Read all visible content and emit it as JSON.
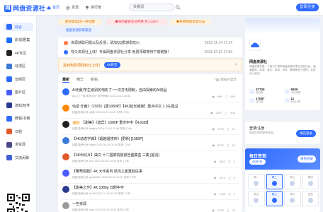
{
  "brand": {
    "name": "网盘资源社"
  },
  "nav": {
    "home": "首页",
    "discover": "发现",
    "rank": "排行榜"
  },
  "search": {
    "value": "关键词"
  },
  "header": {
    "login": "登录/注册"
  },
  "sidebar": {
    "items": [
      {
        "label": "综合",
        "icon": "grid-icon",
        "color": "#2f6bff"
      },
      {
        "label": "影视/剧集",
        "icon": "film-icon",
        "color": "#1f6fff"
      },
      {
        "label": "4K专区",
        "icon": "4k-icon",
        "color": "#222222"
      },
      {
        "label": "动漫区",
        "icon": "anime-icon",
        "color": "#3a7bd5"
      },
      {
        "label": "音频区",
        "icon": "music-icon",
        "color": "#2f6bff"
      },
      {
        "label": "图片区",
        "icon": "image-icon",
        "color": "#4b5cff"
      },
      {
        "label": "游戏/软件",
        "icon": "game-icon",
        "color": "#2a3b8f"
      },
      {
        "label": "教程/书籍",
        "icon": "book-icon",
        "color": "#2f6bff"
      },
      {
        "label": "日剧",
        "icon": "calendar-icon",
        "color": "#e05a2b"
      },
      {
        "label": "求资源",
        "icon": "help-icon",
        "color": "#4a4a8a"
      },
      {
        "label": "交流闲聊",
        "icon": "chat-icon",
        "color": "#3f61d4"
      }
    ]
  },
  "chips": [
    {
      "label": "愿世間美好(一帶觉醒",
      "bg": "#fff3e0",
      "fg": "#e07400"
    },
    {
      "label": "◆海豹暑假会员特惠·月入500+",
      "bg": "#ffe6e6",
      "fg": "#e0455b"
    },
    {
      "label": "◆免费网盘资源论坛",
      "bg": "#fff3e0",
      "fg": "#e07400"
    },
    {
      "label": "速度资源获取渠道",
      "bg": "#e9f0ff",
      "fg": "#2f6bff"
    }
  ],
  "notices": [
    {
      "text": "资源获取问题以及反馈，请加QQ群获取加入",
      "date": "2022-11-14 17:14"
    },
    {
      "text": "夸父资源社上线！专属网盘资源社分享 免费领取等待下载链接！",
      "date": "2023-12-22 17:59"
    }
  ],
  "signin_banner": {
    "text": "签到免费领取积分上线！",
    "pill": "4K彩宝",
    "close": "×"
  },
  "tabs": {
    "latest": "最新",
    "hot": "精华",
    "new": "新帖"
  },
  "toggle": {
    "label": "新帖只显示"
  },
  "posts": [
    {
      "title": "AI无敌!学生级别的电影了~一次打无限制，自由探索的AI商品",
      "meta": "AI入门一族  美术设计  和平教育 2022-12-12 23:58",
      "views": "999",
      "comments": "999",
      "tag": "",
      "avatar": "#2f6bff"
    },
    {
      "title": "仙逆 年番2（2025）[更1080P】【4K/蓝光链接】重点中文 1.3G/集总",
      "meta": "网盘资源分享  动漫  2022-08-13 16:47  发布了8天",
      "views": "2297",
      "comments": "400",
      "tag": "",
      "avatar": "#ff8a00"
    },
    {
      "title": "【甜美】《诡异》1080P 重庆中字【4.6GB】",
      "meta": "网盘资源分享  fanguy  2024-01-15 21:48  发帖了4天",
      "views": "7278",
      "comments": "10",
      "tag": "最新",
      "avatar": "#222222"
    },
    {
      "title": "【4K动态字典】《超越遁境传》[更新] [1080P]",
      "meta": "网盘资源分享  biiant  2022-09-24 02:00  发布了9天",
      "views": "3122",
      "comments": "62",
      "tag": "",
      "avatar": "#3a7bd5"
    },
    {
      "title": "【4K科幻片】曲文 十二国赋情报报告图集盒 三集 [超清]",
      "meta": "网盘资源分享  foxy  2022-09-18 13:00  发布了1年",
      "views": "2522",
      "comments": "3",
      "tag": "",
      "avatar": "#e05a2b"
    },
    {
      "title": "【葡萄短剧】4K 大作系列 凤鸣之夏重回往事",
      "meta": "网盘资源分享  gus0628a  2022-09-13 12:00  发布了2年",
      "views": "2179",
      "comments": "0",
      "tag": "",
      "avatar": "#4b5cff"
    },
    {
      "title": "【甜美之作】4K 1080p 日剧中字",
      "meta": "网盘资源分享  fox03  2021-11-09 15:35  发布了1年",
      "views": "1788",
      "comments": "2",
      "tag": "",
      "avatar": "#2a3b8f"
    },
    {
      "title": "一些资源",
      "meta": "网盘资源分享  user  2023-10-09 09:42  发布了3年",
      "views": "4728",
      "comments": "32",
      "tag": "",
      "avatar": "#999999"
    }
  ],
  "profile": {
    "name": "网盘资源社",
    "desc": "网盘资源社是一个致力于提供网盘资源分享交流的社区，涵盖影视、动漫、音乐、游戏、软件、教程等多个类别，欢迎加入我们。",
    "stats": [
      {
        "value": "37705",
        "label": "总帖数"
      },
      {
        "value": "5929",
        "label": "今日帖数"
      },
      {
        "value": "17087",
        "label": "会员数"
      },
      {
        "value": "11",
        "label": "在线人数"
      }
    ]
  },
  "login_card": {
    "title": "登录/注册",
    "subtitle": "登录后获得更多权益",
    "button": "请先登录"
  },
  "sign_card": {
    "title": "每日签到",
    "pill": "4K彩号",
    "button": "请先登录",
    "days": [
      {
        "label": "周一",
        "on": false
      },
      {
        "label": "周二",
        "on": true
      },
      {
        "label": "周三",
        "on": false
      },
      {
        "label": "周四",
        "on": false
      },
      {
        "label": "周五",
        "on": false
      },
      {
        "label": "周六",
        "on": true
      },
      {
        "label": "周日",
        "on": false
      },
      {
        "label": "连签",
        "on": false
      }
    ]
  }
}
